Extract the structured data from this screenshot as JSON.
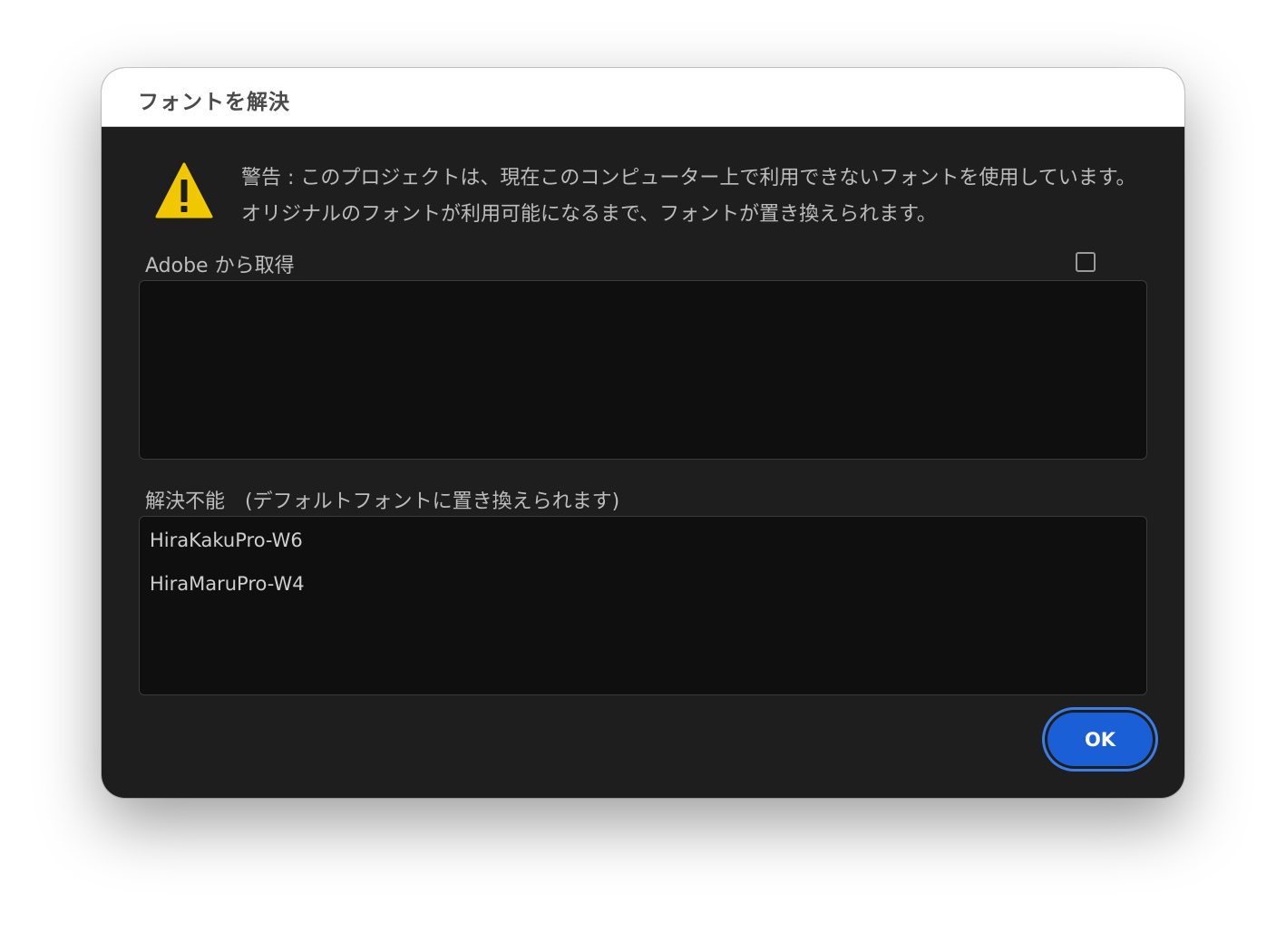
{
  "dialog": {
    "title": "フォントを解決",
    "warning_text": "警告 : このプロジェクトは、現在このコンピューター上で利用できないフォントを使用しています。オリジナルのフォントが利用可能になるまで、フォントが置き換えられます。",
    "adobe_section": {
      "label": "Adobe から取得",
      "checkbox_checked": false,
      "fonts": []
    },
    "unresolved_section": {
      "label": "解決不能　(デフォルトフォントに置き換えられます)",
      "fonts": [
        "HiraKakuPro-W6",
        "HiraMaruPro-W4"
      ]
    },
    "ok_label": "OK"
  },
  "colors": {
    "accent": "#1a5fd6",
    "focus_ring": "#3d7de6",
    "warning": "#f1c800",
    "dialog_bg": "#1e1e1e",
    "list_bg": "#0f0f0f"
  },
  "icons": {
    "warning": "warning-triangle-icon"
  }
}
